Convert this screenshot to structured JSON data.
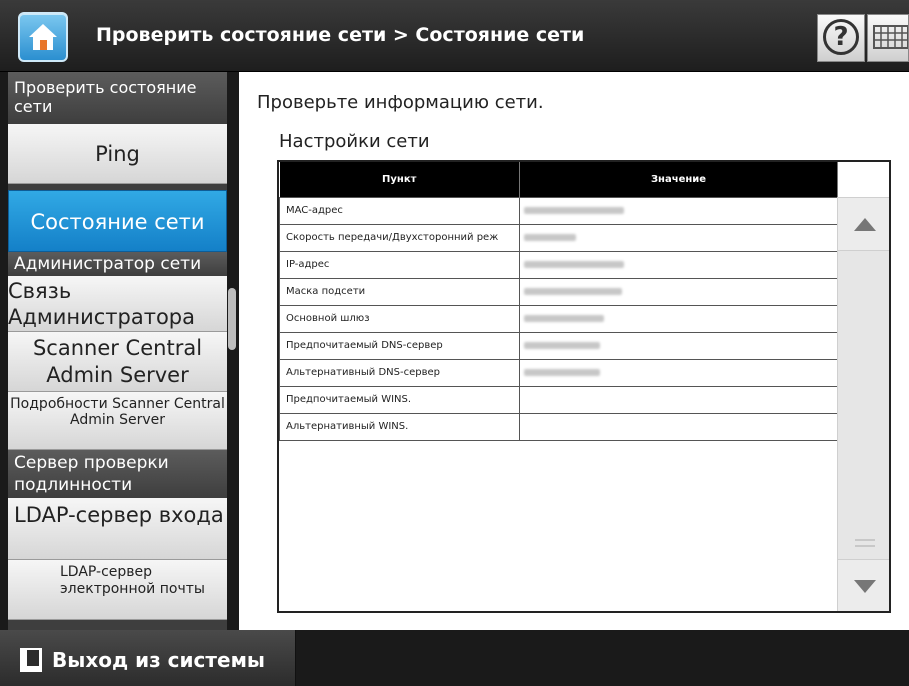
{
  "header": {
    "title": "Проверить состояние сети > Состояние сети",
    "home_icon": "home-icon",
    "help_icon": "help-icon",
    "keyboard_icon": "keyboard-icon",
    "home_color": "#2b8fd0"
  },
  "sidebar": {
    "group_network_check": "Проверить состояние сети",
    "item_ping": "Ping",
    "item_network_status": "Состояние сети",
    "group_network_admin": "Администратор сети",
    "item_admin_connection": "Связь Администратора",
    "item_scas": "Scanner Central Admin Server",
    "item_scas_details": "Подробности Scanner Central Admin Server",
    "group_auth_server": "Сервер проверки подлинности",
    "item_ldap_login": "LDAP-сервер входа",
    "item_ldap_mail": "LDAP-сервер электронной почты",
    "active_color": "#1a8fd6"
  },
  "main": {
    "intro": "Проверьте информацию сети.",
    "section_title": "Настройки сети",
    "table": {
      "columns": [
        "Пункт",
        "Значение"
      ],
      "rows": [
        {
          "item": "MAC-адрес",
          "value_blurred": true
        },
        {
          "item": "Скорость передачи/Двухсторонний реж",
          "value_blurred": true
        },
        {
          "item": "IP-адрес",
          "value_blurred": true
        },
        {
          "item": "Маска подсети",
          "value_blurred": true
        },
        {
          "item": "Основной шлюз",
          "value_blurred": true
        },
        {
          "item": "Предпочитаемый DNS-сервер",
          "value_blurred": true
        },
        {
          "item": "Альтернативный DNS-сервер",
          "value_blurred": true
        },
        {
          "item": "Предпочитаемый WINS.",
          "value_blurred": false
        },
        {
          "item": "Альтернативный WINS.",
          "value_blurred": false
        }
      ]
    }
  },
  "footer": {
    "logout_label": "Выход из системы",
    "logout_icon": "logout-icon"
  }
}
